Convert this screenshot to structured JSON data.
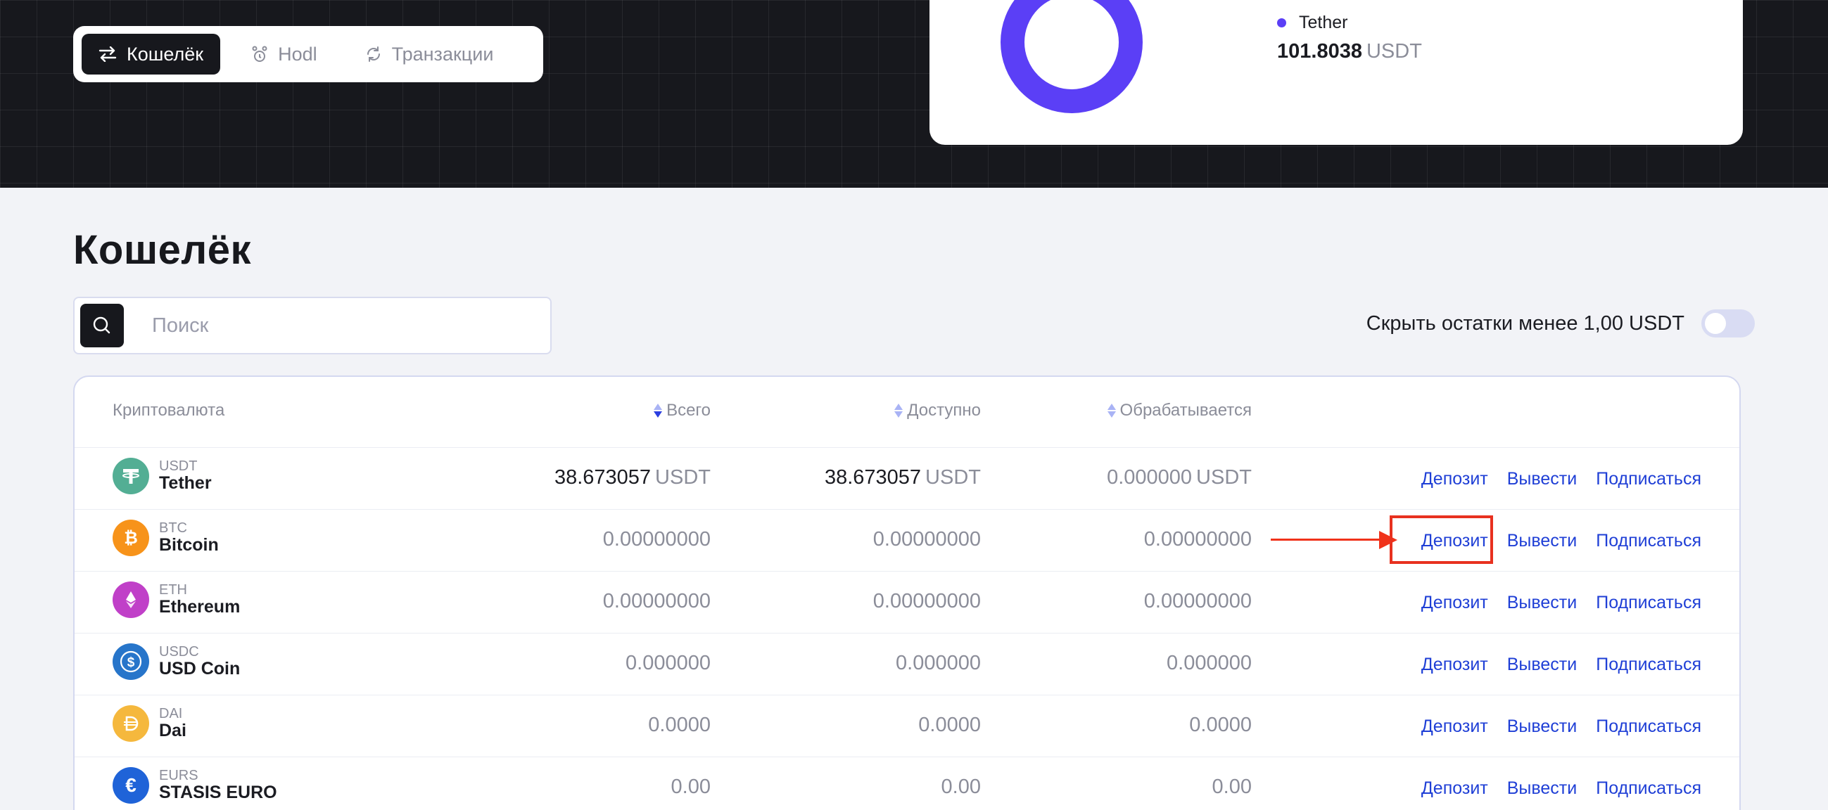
{
  "tabs": [
    {
      "label": "Кошелёк",
      "icon": "transfer-icon",
      "active": true
    },
    {
      "label": "Hodl",
      "icon": "hodl-icon",
      "active": false
    },
    {
      "label": "Транзакции",
      "icon": "refresh-icon",
      "active": false
    }
  ],
  "portfolio": {
    "legend": [
      {
        "name": "Tether",
        "amount": "101.8038",
        "currency": "USDT",
        "color": "#5b3ff6"
      }
    ],
    "donut_share": 1.0
  },
  "page_title": "Кошелёк",
  "search": {
    "placeholder": "Поиск"
  },
  "hide_small": {
    "label": "Скрыть остатки менее 1,00 USDT",
    "enabled": false
  },
  "table": {
    "headers": {
      "crypto": "Криптовалюта",
      "total": "Всего",
      "available": "Доступно",
      "processing": "Обрабатывается"
    },
    "actions": {
      "deposit": "Депозит",
      "withdraw": "Вывести",
      "subscribe": "Подписаться"
    },
    "rows": [
      {
        "symbol": "USDT",
        "name": "Tether",
        "total": "38.673057",
        "total_cur": "USDT",
        "available": "38.673057",
        "available_cur": "USDT",
        "processing": "0.000000",
        "processing_cur": "USDT",
        "color": "#53ae94"
      },
      {
        "symbol": "BTC",
        "name": "Bitcoin",
        "total": "0.00000000",
        "available": "0.00000000",
        "processing": "0.00000000",
        "color": "#f7931a"
      },
      {
        "symbol": "ETH",
        "name": "Ethereum",
        "total": "0.00000000",
        "available": "0.00000000",
        "processing": "0.00000000",
        "color": "#c040c8"
      },
      {
        "symbol": "USDC",
        "name": "USD Coin",
        "total": "0.000000",
        "available": "0.000000",
        "processing": "0.000000",
        "color": "#2775ca"
      },
      {
        "symbol": "DAI",
        "name": "Dai",
        "total": "0.0000",
        "available": "0.0000",
        "processing": "0.0000",
        "color": "#f5b83d"
      },
      {
        "symbol": "EURS",
        "name": "STASIS EURO",
        "total": "0.00",
        "available": "0.00",
        "processing": "0.00",
        "color": "#1f63d8"
      }
    ]
  },
  "colors": {
    "accent": "#1f3fd6",
    "annotation": "#e8311f",
    "dark": "#17181d"
  }
}
